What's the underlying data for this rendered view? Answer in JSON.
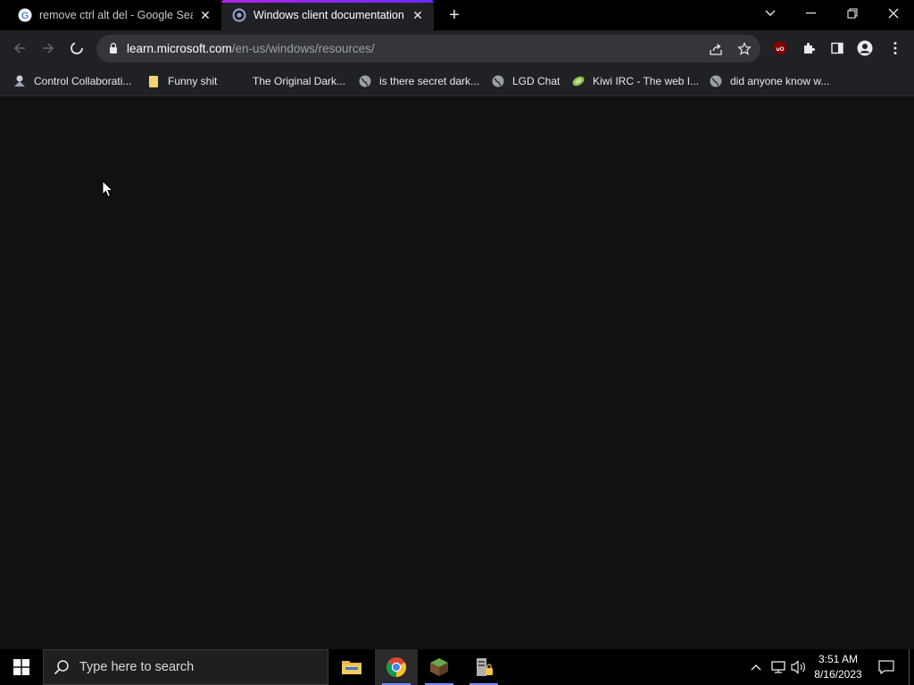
{
  "browser": {
    "tabs": [
      {
        "title": "remove ctrl alt del - Google Sear",
        "favicon": "google-icon",
        "active": false
      },
      {
        "title": "Windows client documentation -",
        "favicon": "microsoft-learn-icon",
        "active": true
      }
    ],
    "omnibox": {
      "url_host": "learn.microsoft.com",
      "url_path": "/en-us/windows/resources/"
    },
    "bookmarks": [
      {
        "label": "Control Collaborati...",
        "icon": "collab-icon"
      },
      {
        "label": "Funny shit",
        "icon": "folder-icon"
      },
      {
        "label": "The Original Dark...",
        "icon": "blank-page-icon"
      },
      {
        "label": "is there secret dark...",
        "icon": "globe-icon"
      },
      {
        "label": "LGD Chat",
        "icon": "globe-icon"
      },
      {
        "label": "Kiwi IRC - The web I...",
        "icon": "kiwi-icon"
      },
      {
        "label": "did anyone know w...",
        "icon": "globe-icon"
      }
    ]
  },
  "taskbar": {
    "search_placeholder": "Type here to search",
    "apps": [
      "file-explorer-icon",
      "chrome-icon",
      "minecraft-icon",
      "server-icon"
    ],
    "clock": {
      "time": "3:51 AM",
      "date": "8/16/2023"
    }
  },
  "colors": {
    "content_bg": "#111112",
    "toolbar_bg": "#202124",
    "tab_accent_start": "#b125e8",
    "tab_accent_end": "#6a2bff",
    "taskbar_bg": "#000000"
  }
}
